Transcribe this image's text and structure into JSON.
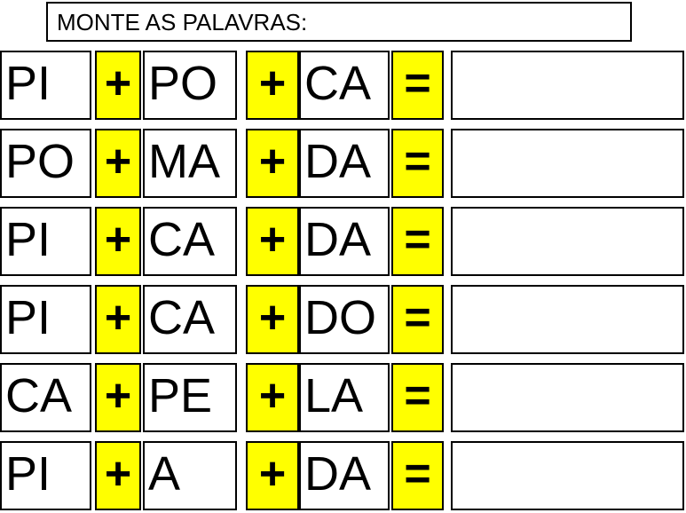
{
  "worksheet": {
    "title": "MONTE AS PALAVRAS:",
    "accent_color": "#FFFF00",
    "border_color": "#000000",
    "background_color": "#FFFFFF",
    "operators": {
      "plus": "+",
      "equals": "="
    },
    "rows": [
      {
        "syllable1": "PI",
        "op1": "+",
        "syllable2": "PO",
        "op2": "+",
        "syllable3": "CA",
        "op3": "=",
        "answer": ""
      },
      {
        "syllable1": "PO",
        "op1": "+",
        "syllable2": "MA",
        "op2": "+",
        "syllable3": "DA",
        "op3": "=",
        "answer": ""
      },
      {
        "syllable1": "PI",
        "op1": "+",
        "syllable2": "CA",
        "op2": "+",
        "syllable3": "DA",
        "op3": "=",
        "answer": ""
      },
      {
        "syllable1": "PI",
        "op1": "+",
        "syllable2": "CA",
        "op2": "+",
        "syllable3": "DO",
        "op3": "=",
        "answer": ""
      },
      {
        "syllable1": "CA",
        "op1": "+",
        "syllable2": "PE",
        "op2": "+",
        "syllable3": "LA",
        "op3": "=",
        "answer": ""
      },
      {
        "syllable1": "PI",
        "op1": "+",
        "syllable2": "A",
        "op2": "+",
        "syllable3": "DA",
        "op3": "=",
        "answer": ""
      }
    ]
  }
}
